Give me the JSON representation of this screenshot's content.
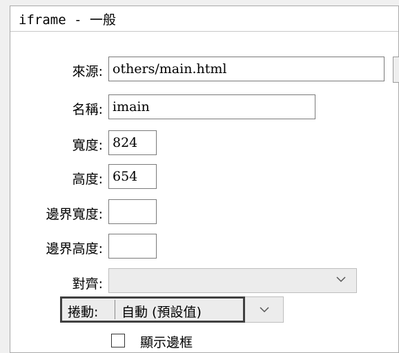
{
  "window": {
    "title": "iframe - 一般"
  },
  "fields": {
    "source": {
      "label": "來源:",
      "value": "others/main.html"
    },
    "name": {
      "label": "名稱:",
      "value": "imain"
    },
    "width": {
      "label": "寬度:",
      "value": "824"
    },
    "height": {
      "label": "高度:",
      "value": "654"
    },
    "margin_width": {
      "label": "邊界寬度:",
      "value": ""
    },
    "margin_height": {
      "label": "邊界高度:",
      "value": ""
    },
    "align": {
      "label": "對齊:",
      "value": ""
    },
    "scrolling": {
      "label": "捲動:",
      "value": "自動 (預設值)"
    },
    "show_border": {
      "label": "顯示邊框",
      "checked": false
    }
  },
  "icons": {
    "dropdown": "chevron-down-icon"
  }
}
